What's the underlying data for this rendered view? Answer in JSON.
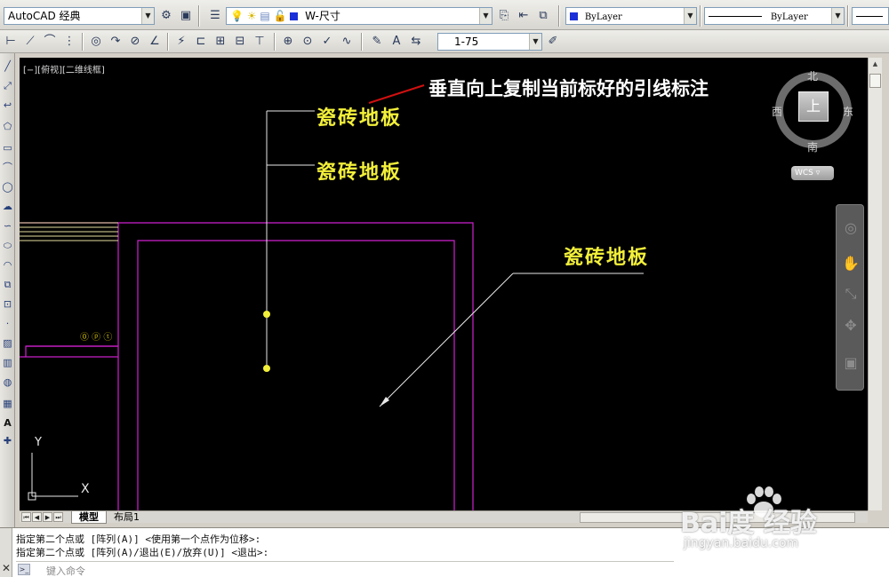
{
  "toolbar1": {
    "workspace": "AutoCAD 经典",
    "dimstyle_label": "W-尺寸",
    "color_label": "ByLayer",
    "linetype_label": "ByLayer"
  },
  "toolbar2": {
    "scale_label": "1-75"
  },
  "viewport": {
    "label": "[−][俯视][二维线框]"
  },
  "drawing": {
    "annotation": "垂直向上复制当前标好的引线标注",
    "leader_texts": [
      "瓷砖地板",
      "瓷砖地板",
      "瓷砖地板"
    ],
    "small_symbols": "⓪ ⓟ ⓣ"
  },
  "viewcube": {
    "north": "北",
    "south": "南",
    "west": "西",
    "east": "东",
    "face": "上",
    "wcs": "WCS ▿"
  },
  "ucs": {
    "x": "X",
    "y": "Y"
  },
  "layout_tabs": {
    "model": "模型",
    "layout1": "布局1"
  },
  "command": {
    "history": [
      "指定第二个点或 [阵列(A)] <使用第一个点作为位移>:",
      "指定第二个点或 [阵列(A)/退出(E)/放弃(U)] <退出>:"
    ],
    "placeholder": "键入命令",
    "icon": ">_"
  },
  "watermark": {
    "main": "Bai度 经验",
    "sub": "jingyan.baidu.com"
  },
  "colors": {
    "canvas": "#000000",
    "magenta_lines": "#d020d0",
    "leader_text": "#f2ef3a",
    "leader_lines": "#e8e8e8",
    "red_arrow": "#d01010"
  }
}
